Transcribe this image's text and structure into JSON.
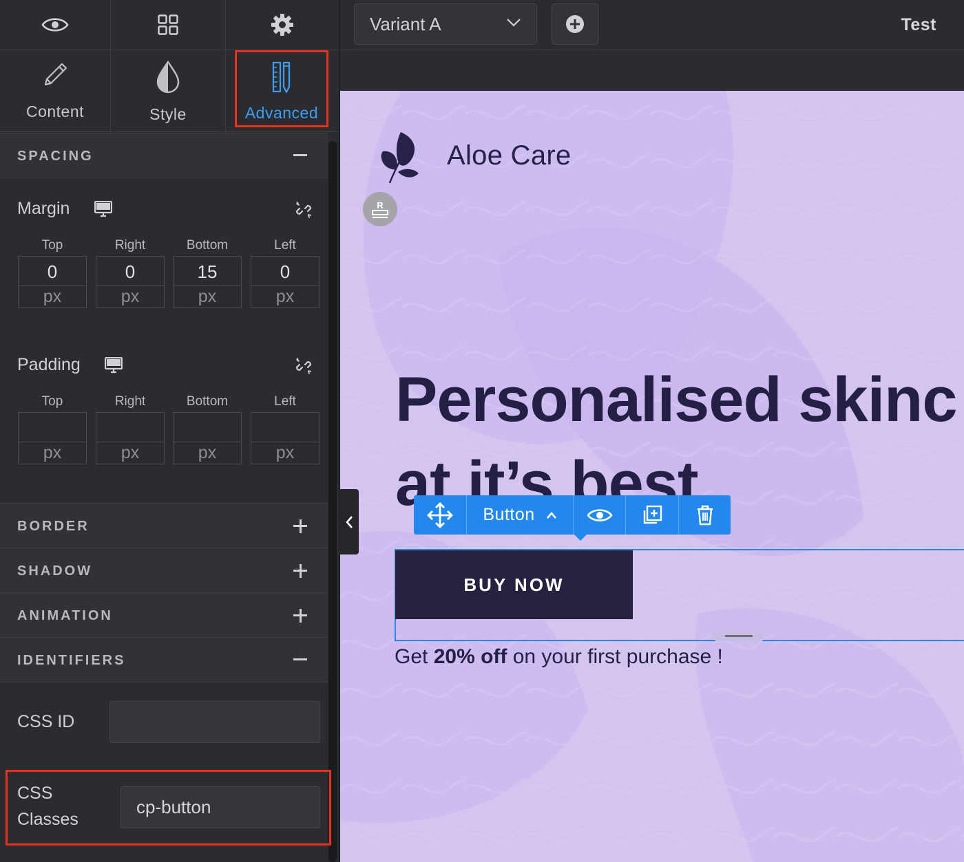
{
  "sidebar": {
    "top_icons": [
      "eye-icon",
      "grid-icon",
      "gear-icon"
    ],
    "tabs": [
      {
        "label": "Content",
        "icon": "pencil-icon"
      },
      {
        "label": "Style",
        "icon": "drop-icon"
      },
      {
        "label": "Advanced",
        "icon": "ruler-pencil-icon",
        "active": true
      }
    ],
    "spacing": {
      "title": "SPACING",
      "margin": {
        "title": "Margin",
        "columns": [
          "Top",
          "Right",
          "Bottom",
          "Left"
        ],
        "values": [
          "0",
          "0",
          "15",
          "0"
        ],
        "units": [
          "px",
          "px",
          "px",
          "px"
        ]
      },
      "padding": {
        "title": "Padding",
        "columns": [
          "Top",
          "Right",
          "Bottom",
          "Left"
        ],
        "values": [
          "",
          "",
          "",
          ""
        ],
        "units": [
          "px",
          "px",
          "px",
          "px"
        ]
      }
    },
    "sections": [
      {
        "title": "BORDER",
        "state": "collapsed"
      },
      {
        "title": "SHADOW",
        "state": "collapsed"
      },
      {
        "title": "ANIMATION",
        "state": "collapsed"
      }
    ],
    "identifiers": {
      "title": "IDENTIFIERS",
      "css_id_label": "CSS ID",
      "css_id_value": "",
      "css_classes_label_1": "CSS",
      "css_classes_label_2": "Classes",
      "css_classes_value": "cp-button"
    }
  },
  "topbar": {
    "variant": "Variant A",
    "test_label": "Test"
  },
  "canvas": {
    "brand": "Aloe Care",
    "headline_line1": "Personalised skinc",
    "headline_line2": "at it’s best.",
    "toolbar": {
      "element_label": "Button"
    },
    "cta_label": "BUY NOW",
    "promo_prefix": "Get ",
    "promo_bold": "20% off",
    "promo_suffix": " on your first purchase !"
  },
  "colors": {
    "accent_blue": "#2288ee",
    "highlight_red": "#e8321e",
    "canvas_bg": "#d3c4f0",
    "button_dark": "#25213f"
  }
}
